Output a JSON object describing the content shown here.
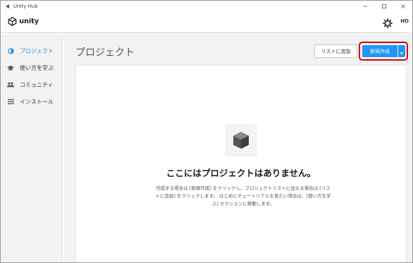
{
  "window": {
    "title": "Unity Hub"
  },
  "header": {
    "logo_text": "unity",
    "avatar_initials": "HO"
  },
  "sidebar": {
    "items": [
      {
        "label": "プロジェクト",
        "icon": "projects-icon",
        "active": true
      },
      {
        "label": "使い方を学ぶ",
        "icon": "learn-icon",
        "active": false
      },
      {
        "label": "コミュニティ",
        "icon": "community-icon",
        "active": false
      },
      {
        "label": "インストール",
        "icon": "installs-icon",
        "active": false
      }
    ]
  },
  "main": {
    "title": "プロジェクト",
    "add_to_list_label": "リストに追加",
    "new_label": "新規作成",
    "empty_title": "ここにはプロジェクトはありません。",
    "empty_description": "作成する場合は [新規作成] をクリックし、プロジェクトリストに加える場合は [リストに追加] をクリックします。 はじめにチュートリアルを見たい場合は、[使い方を学ぶ] セクションに移動します。"
  },
  "colors": {
    "accent": "#2196f3",
    "highlight_border": "#d9000d"
  }
}
